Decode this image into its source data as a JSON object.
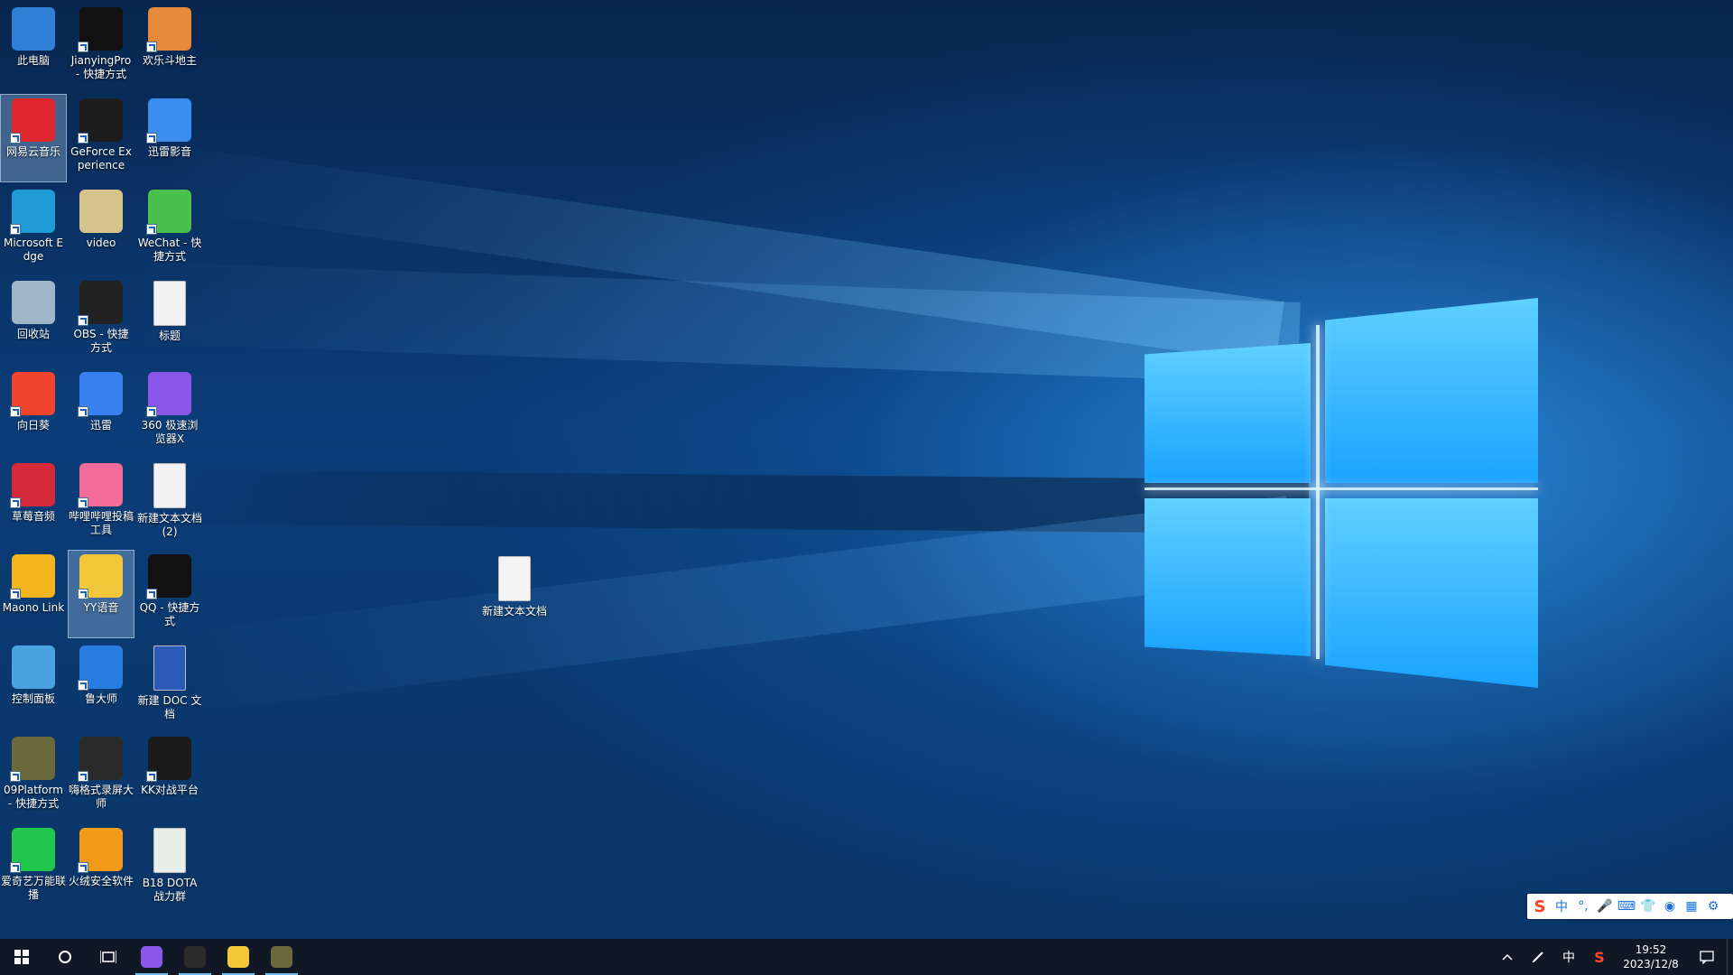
{
  "desktop": {
    "icons": [
      {
        "label": "此电脑",
        "icon": "computer-icon",
        "color": "#2f7fd6"
      },
      {
        "label": "JianyingPro - 快捷方式",
        "icon": "jianying-icon",
        "color": "#111111"
      },
      {
        "label": "欢乐斗地主",
        "icon": "doudizhu-icon",
        "color": "#e48a3a"
      },
      {
        "label": "网易云音乐",
        "icon": "netease-music-icon",
        "color": "#e0262d"
      },
      {
        "label": "GeForce Experience",
        "icon": "geforce-icon",
        "color": "#1d1d1d"
      },
      {
        "label": "迅雷影音",
        "icon": "xunlei-player-icon",
        "color": "#3b8df0"
      },
      {
        "label": "Microsoft Edge",
        "icon": "edge-icon",
        "color": "#1e9bd7"
      },
      {
        "label": "video",
        "icon": "folder-icon",
        "color": "#d8c38a"
      },
      {
        "label": "WeChat - 快捷方式",
        "icon": "wechat-icon",
        "color": "#48c04a"
      },
      {
        "label": "回收站",
        "icon": "recycle-bin-icon",
        "color": "#9fb6c8"
      },
      {
        "label": "OBS - 快捷方式",
        "icon": "obs-icon",
        "color": "#222222"
      },
      {
        "label": "标题",
        "icon": "text-file-icon",
        "color": "#f2f2f2"
      },
      {
        "label": "向日葵",
        "icon": "sunlogin-icon",
        "color": "#f0442c"
      },
      {
        "label": "迅雷",
        "icon": "xunlei-icon",
        "color": "#3a7ff0"
      },
      {
        "label": "360 极速浏览器X",
        "icon": "360-browser-icon",
        "color": "#8a56e8"
      },
      {
        "label": "草莓音频",
        "icon": "strawberry-icon",
        "color": "#d62a3a"
      },
      {
        "label": "哔哩哔哩投稿工具",
        "icon": "bilibili-icon",
        "color": "#f36c9a"
      },
      {
        "label": "新建文本文档 (2)",
        "icon": "text-file-icon",
        "color": "#f2f2f2"
      },
      {
        "label": "Maono Link",
        "icon": "maono-icon",
        "color": "#f2b51c"
      },
      {
        "label": "YY语音",
        "icon": "yy-icon",
        "color": "#f3c73a"
      },
      {
        "label": "QQ - 快捷方式",
        "icon": "qq-icon",
        "color": "#111111"
      },
      {
        "label": "控制面板",
        "icon": "control-panel-icon",
        "color": "#4aa3e0"
      },
      {
        "label": "鲁大师",
        "icon": "ludashi-icon",
        "color": "#2a7de0"
      },
      {
        "label": "新建 DOC 文档",
        "icon": "doc-file-icon",
        "color": "#2b5bb8"
      },
      {
        "label": "09Platform - 快捷方式",
        "icon": "09platform-icon",
        "color": "#6b6a3c"
      },
      {
        "label": "嗨格式录屏大师",
        "icon": "screen-recorder-icon",
        "color": "#2a2a2a"
      },
      {
        "label": "KK对战平台",
        "icon": "kk-icon",
        "color": "#1b1b1b"
      },
      {
        "label": "爱奇艺万能联播",
        "icon": "iqiyi-icon",
        "color": "#1fc84a"
      },
      {
        "label": "火绒安全软件",
        "icon": "huorong-icon",
        "color": "#f29a1a"
      },
      {
        "label": "B18 DOTA战力群",
        "icon": "spreadsheet-file-icon",
        "color": "#e8efe8"
      }
    ],
    "loose_icon": {
      "label": "新建文本文档",
      "icon": "text-file-icon"
    }
  },
  "ime_bar": {
    "items": [
      "S",
      "中",
      "°,",
      "🎤",
      "⌨",
      "👕",
      "◉",
      "▦",
      "⚙"
    ]
  },
  "taskbar": {
    "pinned": [
      {
        "icon": "360-browser-icon"
      },
      {
        "icon": "obs-icon"
      },
      {
        "icon": "yy-icon"
      },
      {
        "icon": "09platform-icon"
      }
    ],
    "tray": {
      "lang": "中",
      "time": "19:52",
      "date": "2023/12/8"
    }
  }
}
